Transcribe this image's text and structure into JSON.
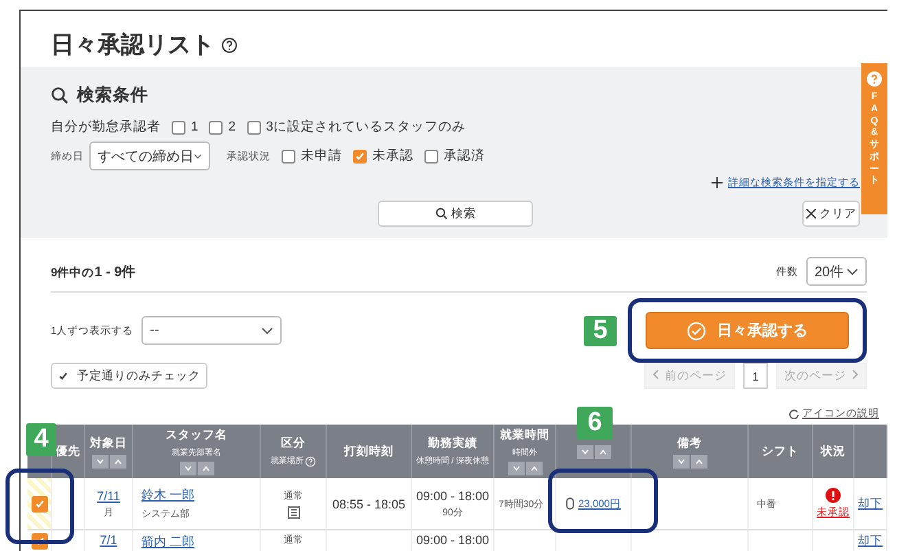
{
  "title": "日々承認リスト",
  "faq_tab": "FAQ&サポート",
  "search": {
    "heading": "検索条件",
    "approver_label": "自分が勤怠承認者",
    "approver_options": [
      {
        "label": "1",
        "checked": false
      },
      {
        "label": "2",
        "checked": false
      },
      {
        "label": "3に設定されているスタッフのみ",
        "checked": false
      }
    ],
    "closing_label": "締め日",
    "closing_value": "すべての締め日",
    "status_label": "承認状況",
    "status_options": [
      {
        "label": "未申請",
        "checked": false
      },
      {
        "label": "未承認",
        "checked": true
      },
      {
        "label": "承認済",
        "checked": false
      }
    ],
    "advanced_link": "詳細な検索条件を指定する",
    "search_button": "検索",
    "clear_button": "クリア"
  },
  "results": {
    "summary_prefix": "9件中の",
    "summary_range": "1 - 9件",
    "count_label": "件数",
    "count_value": "20件",
    "per_person_label": "1人ずつ表示する",
    "per_person_value": "--",
    "approve_button": "日々承認する",
    "check_button": "予定通りのみチェック",
    "prev": "前のページ",
    "page": "1",
    "next": "次のページ",
    "icon_help": "アイコンの説明"
  },
  "callouts": [
    "4",
    "5",
    "6"
  ],
  "table": {
    "columns": [
      {
        "sortable": false
      },
      {
        "label": "優先",
        "sortable": false
      },
      {
        "label": "対象日",
        "sortable": true
      },
      {
        "label": "スタッフ名",
        "sub": "就業先部署名",
        "sortable": true
      },
      {
        "label": "区分",
        "sub": "就業場所",
        "help": true,
        "sortable": false
      },
      {
        "label": "打刻時刻",
        "sortable": false
      },
      {
        "label": "勤務実績",
        "sub": "休憩時間 / 深夜休憩",
        "sortable": false
      },
      {
        "label": "就業時間",
        "sub": "時間外",
        "sortable": true
      },
      {
        "sortable": true
      },
      {
        "label": "備考",
        "sortable": true
      },
      {
        "label": "シフト",
        "sortable": false
      },
      {
        "label": "状況",
        "sortable": false
      },
      {
        "sortable": false
      }
    ],
    "rows": [
      {
        "checked": true,
        "highlight": true,
        "date": "7/11",
        "weekday": "月",
        "name": "鈴木 一郎",
        "dept": "システム部",
        "type": "通常",
        "stamp": "08:55 - 18:05",
        "actual": "09:00 - 18:00",
        "break": "90分",
        "hours": "7時間30分",
        "expense": "23,000円",
        "shift": "中番",
        "status": "未承認",
        "action": "却下"
      },
      {
        "checked": true,
        "highlight": false,
        "date": "7/1",
        "name": "箭内 二郎",
        "type": "通常",
        "actual": "09:00 - 18:00",
        "action": "却下"
      }
    ]
  }
}
